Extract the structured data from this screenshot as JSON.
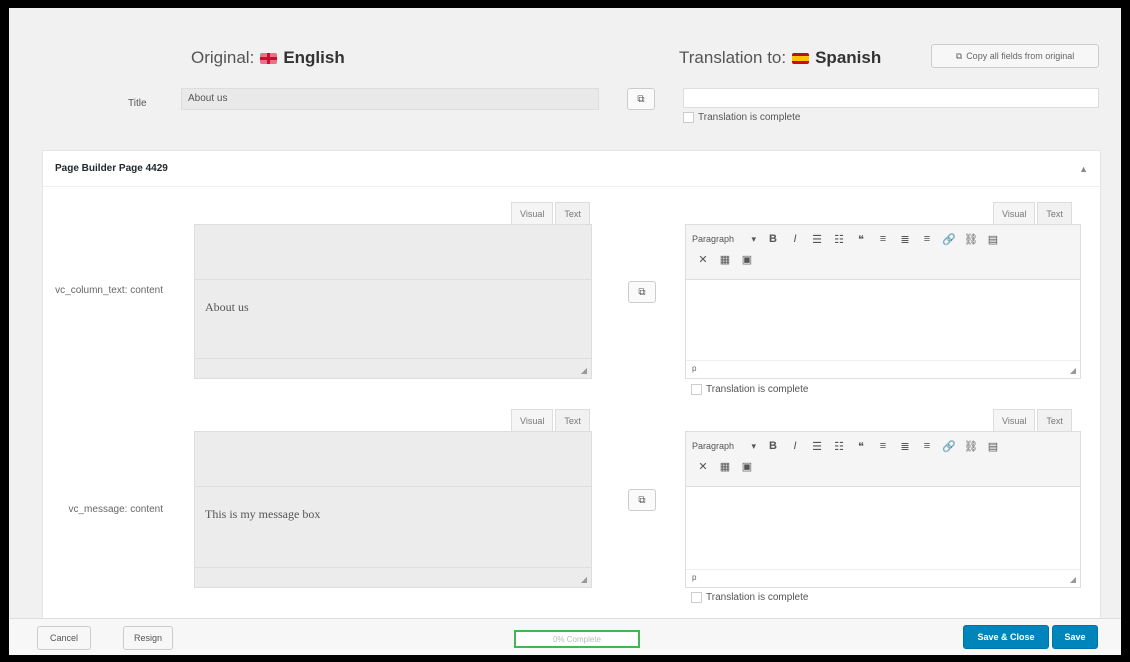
{
  "header": {
    "original_label": "Original:",
    "original_lang": "English",
    "translation_label": "Translation to:",
    "translation_lang": "Spanish",
    "copy_all_label": "Copy all fields from original"
  },
  "title_field": {
    "label": "Title",
    "original_value": "About us",
    "translation_value": "",
    "complete_label": "Translation is complete"
  },
  "section": {
    "title": "Page Builder Page 4429",
    "collapse_icon": "▲"
  },
  "fields": [
    {
      "label": "vc_column_text: content",
      "tab_visual": "Visual",
      "tab_text": "Text",
      "original_value": "About us",
      "status_path": "p",
      "complete_label": "Translation is complete"
    },
    {
      "label": "vc_message: content",
      "tab_visual": "Visual",
      "tab_text": "Text",
      "original_value": "This is my message box",
      "status_path": "p",
      "complete_label": "Translation is complete"
    }
  ],
  "toolbar": {
    "format_label": "Paragraph",
    "icons": [
      "bold-icon",
      "italic-icon",
      "bullet-list-icon",
      "numbered-list-icon",
      "blockquote-icon",
      "align-left-icon",
      "align-center-icon",
      "align-right-icon",
      "link-icon",
      "unlink-icon",
      "toolbar-toggle-icon"
    ],
    "row2_icons": [
      "fullscreen-icon",
      "table-icon",
      "image-icon"
    ]
  },
  "footer": {
    "cancel_label": "Cancel",
    "resign_label": "Resign",
    "progress_text": "0% Complete",
    "progress_value": 0,
    "save_close_label": "Save & Close",
    "save_label": "Save"
  },
  "colors": {
    "primary": "#0085ba",
    "progress_border": "#46b450"
  }
}
